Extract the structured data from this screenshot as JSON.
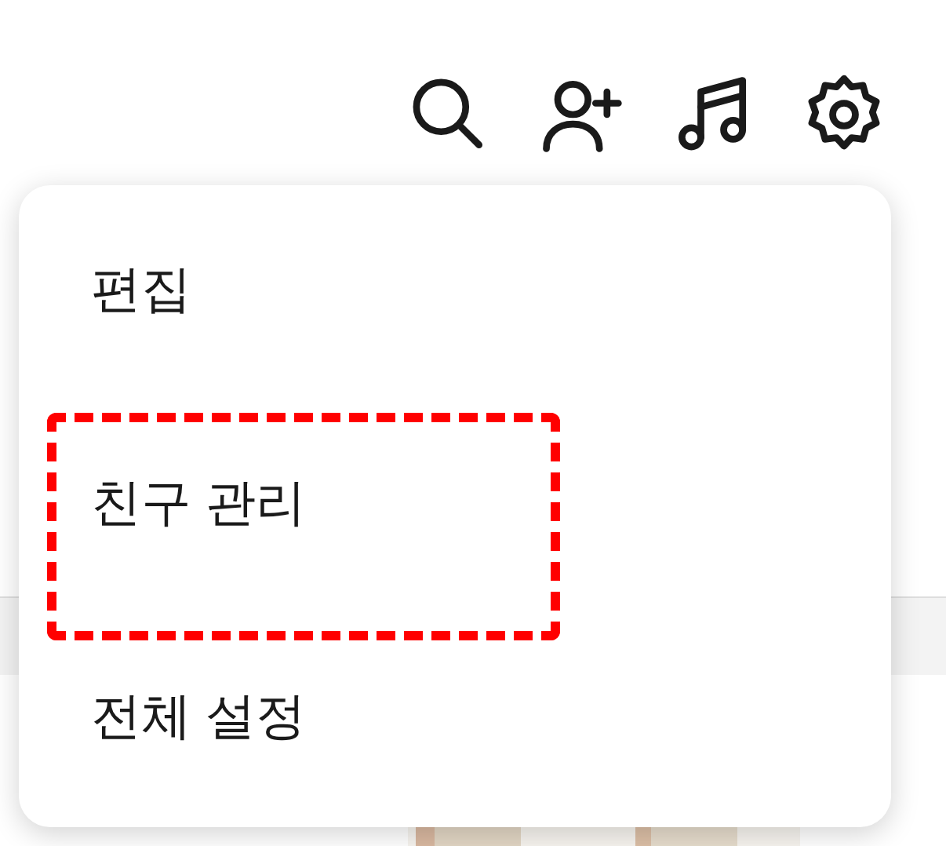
{
  "toolbar": [
    {
      "kind": "search"
    },
    {
      "kind": "add-friend"
    },
    {
      "kind": "music"
    },
    {
      "kind": "settings"
    }
  ],
  "menu": {
    "items": [
      {
        "label": "편집",
        "highlighted": false
      },
      {
        "label": "친구 관리",
        "highlighted": true
      },
      {
        "label": "전체 설정",
        "highlighted": false
      }
    ]
  }
}
